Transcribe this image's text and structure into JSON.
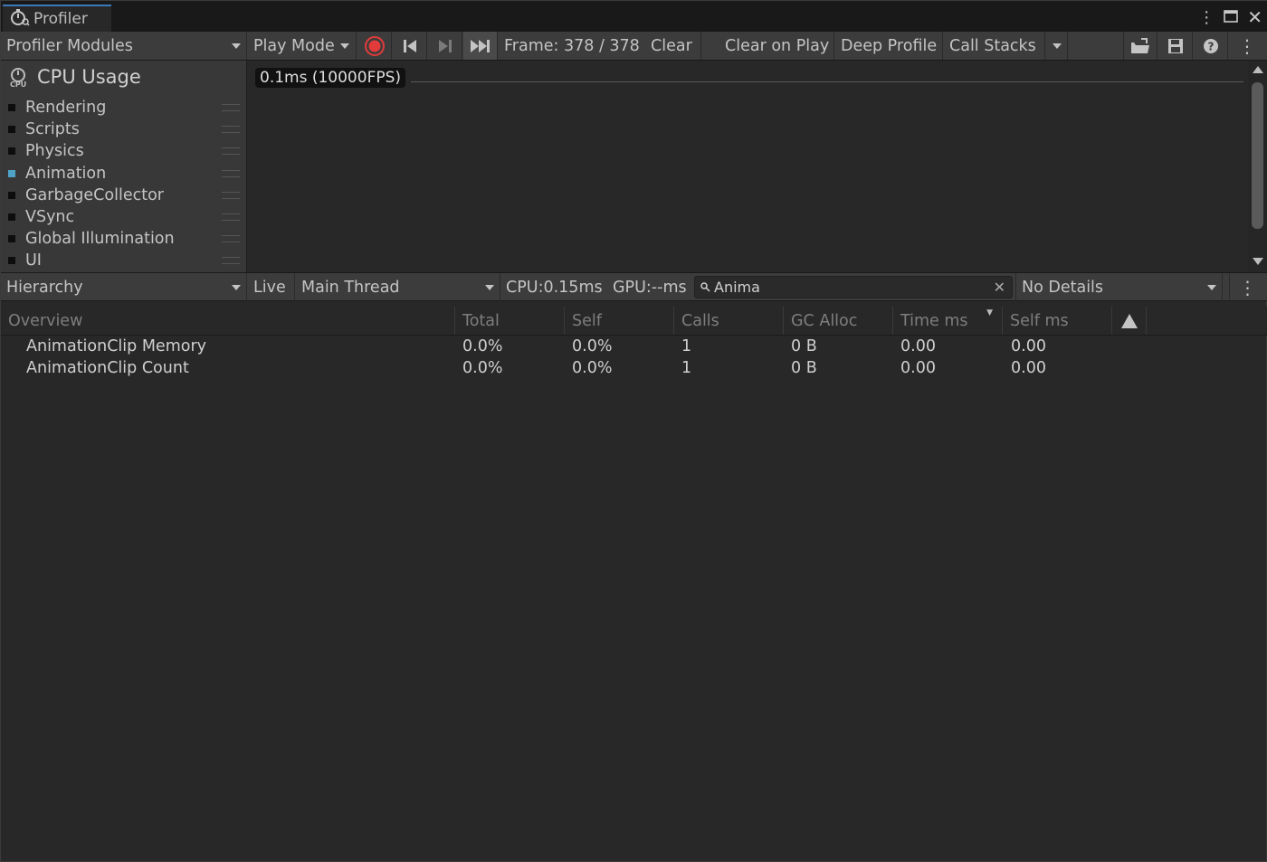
{
  "window": {
    "tab_title": "Profiler",
    "tab_icon": "profiler-icon",
    "controls": [
      "menu-dots-icon",
      "maximize-icon",
      "close-icon"
    ]
  },
  "toolbar": {
    "modules_dropdown": "Profiler Modules",
    "play_mode": "Play Mode",
    "record_icon": "record-icon",
    "frame": "Frame: 378 / 378",
    "clear": "Clear",
    "clear_on_play": "Clear on Play",
    "deep_profile": "Deep Profile",
    "call_stacks": "Call Stacks"
  },
  "modules": {
    "title": "CPU Usage",
    "items": [
      {
        "label": "Rendering",
        "color": "#0d0d0d"
      },
      {
        "label": "Scripts",
        "color": "#0d0d0d"
      },
      {
        "label": "Physics",
        "color": "#0d0d0d"
      },
      {
        "label": "Animation",
        "color": "#4fa3c7"
      },
      {
        "label": "GarbageCollector",
        "color": "#0d0d0d"
      },
      {
        "label": "VSync",
        "color": "#0d0d0d"
      },
      {
        "label": "Global Illumination",
        "color": "#0d0d0d"
      },
      {
        "label": "UI",
        "color": "#0d0d0d"
      }
    ]
  },
  "chart": {
    "fps_label": "0.1ms (10000FPS)"
  },
  "details": {
    "view": "Hierarchy",
    "live": "Live",
    "thread": "Main Thread",
    "cpu": "CPU:0.15ms",
    "gpu": "GPU:--ms",
    "search_value": "Anima",
    "details_mode": "No Details"
  },
  "table": {
    "headers": [
      "Overview",
      "Total",
      "Self",
      "Calls",
      "GC Alloc",
      "Time ms",
      "Self ms"
    ],
    "rows": [
      [
        "AnimationClip Memory",
        "0.0%",
        "0.0%",
        "1",
        "0 B",
        "0.00",
        "0.00"
      ],
      [
        "AnimationClip Count",
        "0.0%",
        "0.0%",
        "1",
        "0 B",
        "0.00",
        "0.00"
      ]
    ]
  }
}
